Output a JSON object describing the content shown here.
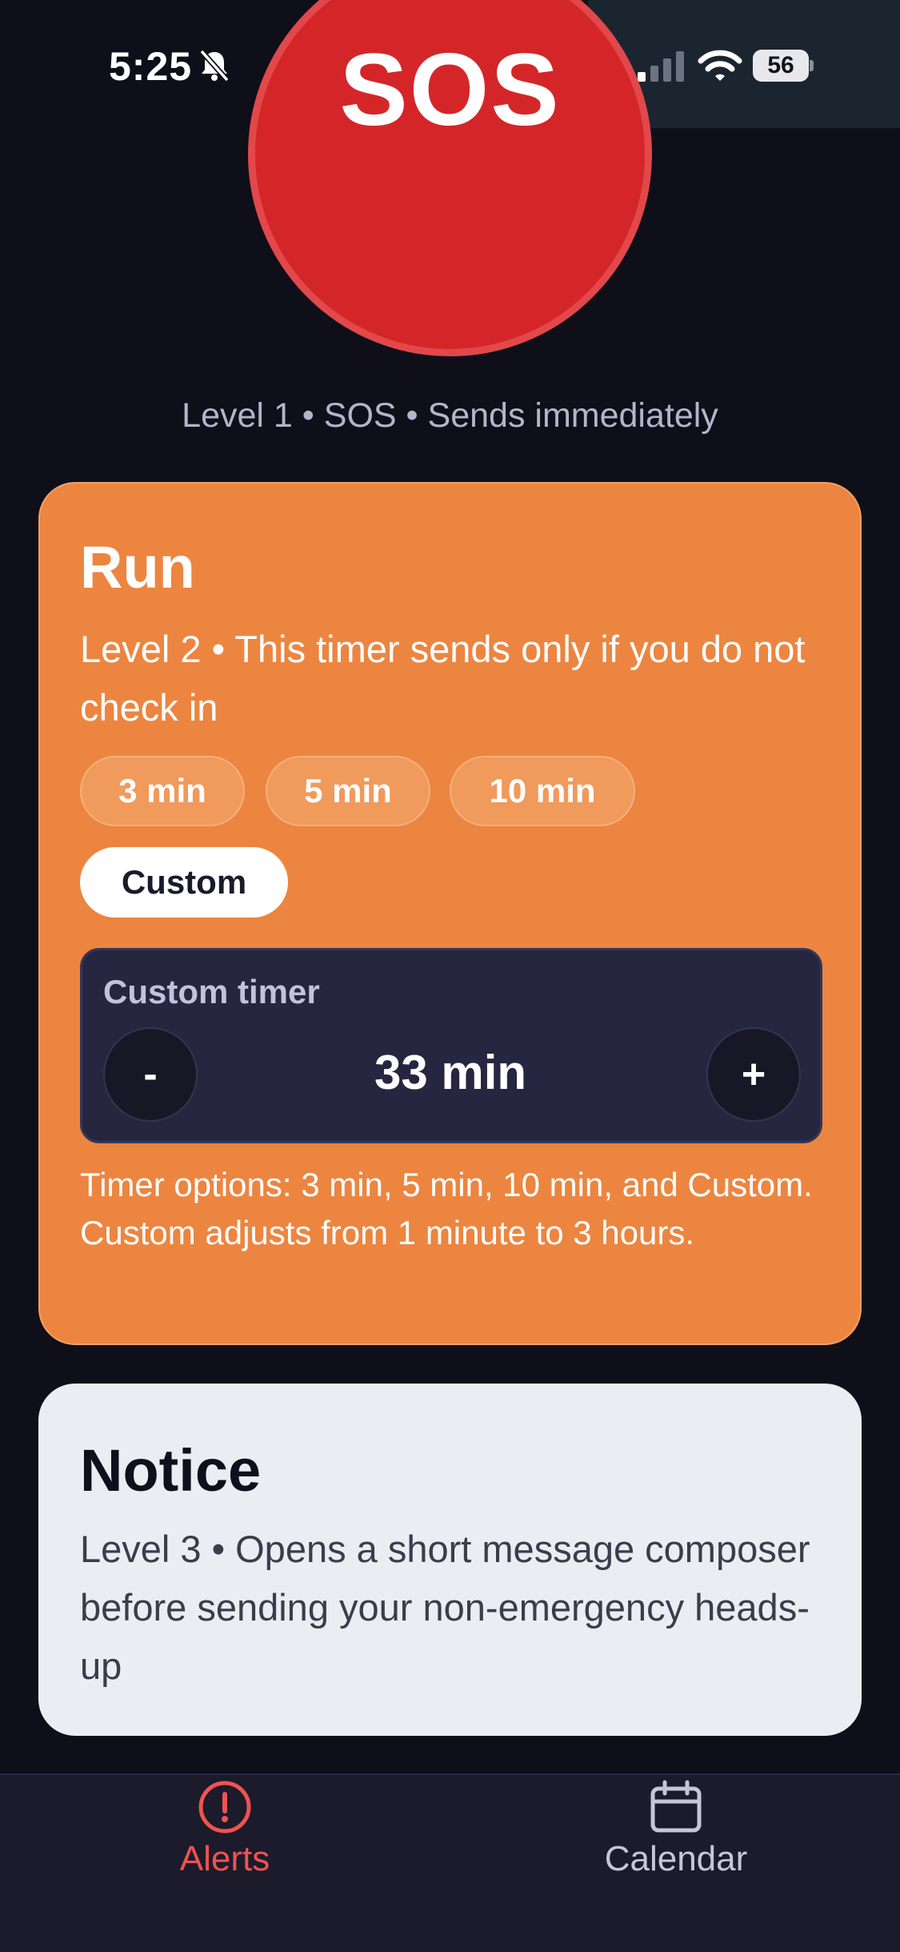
{
  "status_bar": {
    "time": "5:25",
    "battery": "56"
  },
  "sos": {
    "label": "SOS",
    "caption": "Level 1 • SOS • Sends immediately"
  },
  "run": {
    "title": "Run",
    "description": "Level 2 • This timer sends only if you do not check in",
    "options": [
      "3 min",
      "5 min",
      "10 min",
      "Custom"
    ],
    "selected_option": "Custom",
    "custom_timer_label": "Custom timer",
    "decrement_label": "-",
    "increment_label": "+",
    "custom_value": "33 min",
    "note": "Timer options: 3 min, 5 min, 10 min, and Custom. Custom adjusts from 1 minute to 3 hours."
  },
  "notice": {
    "title": "Notice",
    "description": "Level 3 • Opens a short message composer before sending your non-emergency heads-up"
  },
  "tab_bar": {
    "tabs": [
      {
        "label": "Alerts",
        "icon": "alert-circle-icon",
        "active": true
      },
      {
        "label": "Calendar",
        "icon": "calendar-icon",
        "active": false
      }
    ]
  },
  "colors": {
    "background": "#0f0f1a",
    "sos_red": "#d42629",
    "run_orange": "#ec8540",
    "notice_bg": "#ecedf2",
    "active_tab": "#ef5350"
  }
}
